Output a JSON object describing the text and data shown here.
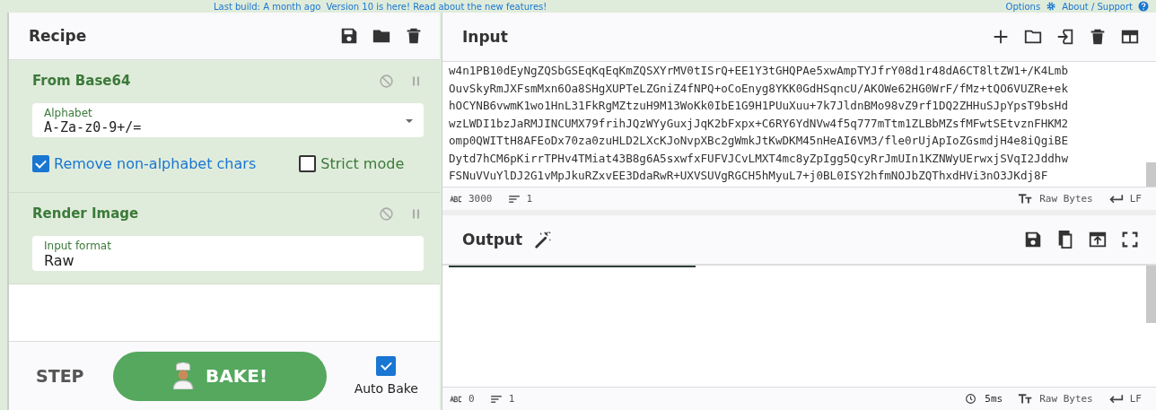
{
  "banner": {
    "build_text": "Last build: A month ago",
    "version_text": "Version 10 is here! Read about the new features!",
    "options_label": "Options",
    "about_label": "About / Support"
  },
  "recipe": {
    "title": "Recipe",
    "operations": [
      {
        "name": "From Base64",
        "fields": [
          {
            "kind": "dropdown",
            "label": "Alphabet",
            "value": "A-Za-z0-9+/="
          }
        ],
        "checkboxes": [
          {
            "label": "Remove non-alphabet chars",
            "checked": true
          },
          {
            "label": "Strict mode",
            "checked": false
          }
        ]
      },
      {
        "name": "Render Image",
        "fields": [
          {
            "kind": "text",
            "label": "Input format",
            "value": "Raw"
          }
        ]
      }
    ]
  },
  "controls": {
    "step_label": "STEP",
    "bake_label": "BAKE!",
    "auto_bake": {
      "label": "Auto Bake",
      "checked": true
    }
  },
  "input": {
    "title": "Input",
    "lines": [
      "w4n1PB10dEyNgZQSbGSEqKqEqKmZQSXYrMV0tISrQ+EE1Y3tGHQPAe5xwAmpTYJfrY08d1r48dA6CT8ltZW1+/K4Lmb",
      "OuvSkyRmJXFsmMxn6Oa8SHgXUPTeLZGniZ4fNPQ+oCoEnyg8YKK0GdHSqncU/AKOWe62HG0WrF/fMz+tQO6VUZRe+ek",
      "hOCYNB6vwmK1wo1HnL31FkRgMZtzuH9M13WoKk0IbE1G9H1PUuXuu+7k7JldnBMo98vZ9rf1DQ2ZHHuSJpYpsT9bsHd",
      "wzLWDI1bzJaRMJINCUMX79frihJQzWYyGuxjJqK2bFxpx+C6RY6YdNVw4f5q777mTtm1ZLBbMZsfMFwtSEtvznFHKM2",
      "omp0QWITtH8AFEoDx70za0zuHLD2LXcKJoNvpXBc2gWmkJtKwDKM45nHeAI6VM3/fle0rUjApIoZGsmdjH4e8iQgiBE",
      "Dytd7hCM6pKirrTPHv4TMiat43B8g6A5sxwfxFUFVJCvLMXT4mc8yZpIgg5QcyRrJmUIn1KZNWyUErwxjSVqI2Jddhw",
      "FSNuVVuYlDJ2G1vMpJkuRZxvEE3DdaRwR+UXVSUVgRGCH5hMyuL7+j0BL0ISY2hfmNOJbZQThxdHVi3nO3JKdj8F"
    ],
    "status": {
      "chars": "3000",
      "lines": "1",
      "format": "Raw Bytes",
      "eol": "LF"
    }
  },
  "output": {
    "title": "Output",
    "status": {
      "chars": "0",
      "lines": "1",
      "time": "5ms",
      "format": "Raw Bytes",
      "eol": "LF"
    }
  }
}
